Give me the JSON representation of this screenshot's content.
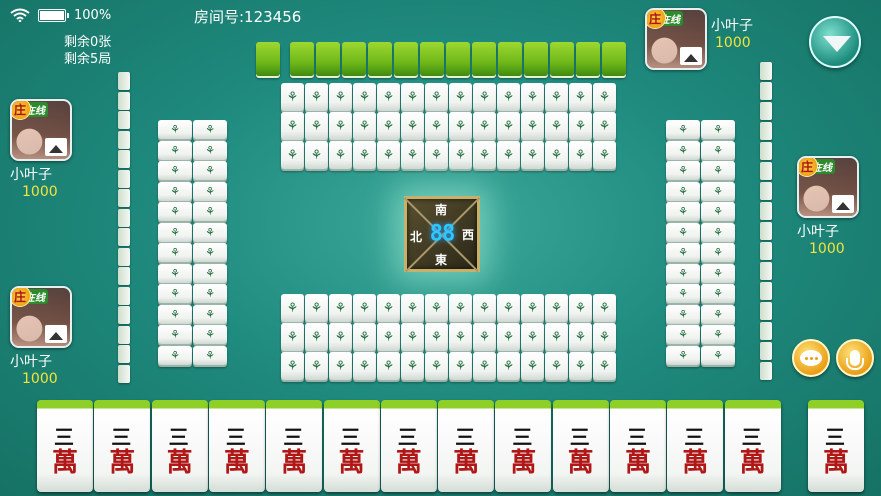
{
  "status": {
    "battery": "100%",
    "battery_level": 1.0
  },
  "room": {
    "label": "房间号:123456"
  },
  "remaining": {
    "cards": "剩余0张",
    "rounds": "剩余5局"
  },
  "badges": {
    "dealer": "庄",
    "online": "在线"
  },
  "players": [
    {
      "position": "top",
      "name": "小叶子",
      "score": "1000"
    },
    {
      "position": "left-top",
      "name": "小叶子",
      "score": "1000"
    },
    {
      "position": "right",
      "name": "小叶子",
      "score": "1000"
    },
    {
      "position": "left-bottom",
      "name": "小叶子",
      "score": "1000"
    }
  ],
  "compass": {
    "north": "北",
    "south": "南",
    "east": "東",
    "west": "西",
    "timer": "88"
  },
  "hand_tile": {
    "top": "三",
    "bottom": "萬"
  },
  "discard_mark": "⚘",
  "colors": {
    "table": "#1f8a7e",
    "tile_back": "#7ec224",
    "score": "#f3e33a",
    "timer": "#2ac8ff"
  }
}
